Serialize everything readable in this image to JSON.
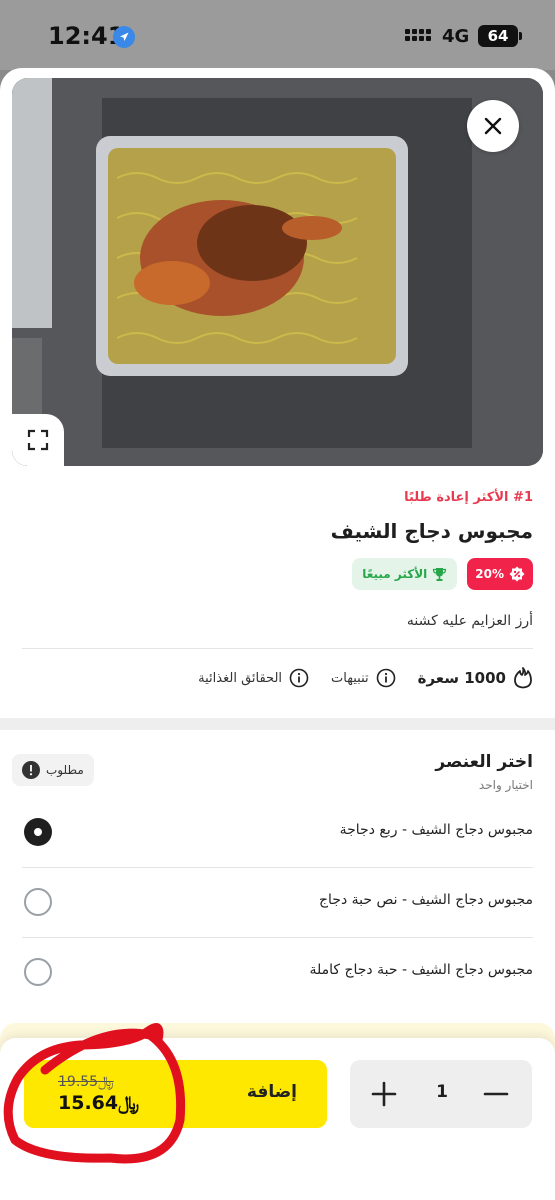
{
  "status_bar": {
    "time": "12:41",
    "network": "4G",
    "battery": "64"
  },
  "product": {
    "reorder_tag": "#1 الأكثر إعادة طلبًا",
    "name": "مجبوس دجاج الشيف",
    "discount_badge": "20%",
    "best_seller_badge": "الأكثر مبيعًا",
    "description": "أرز العزايم عليه كشنه",
    "calories": "1000 سعرة",
    "alerts_label": "تنبيهات",
    "nutrition_label": "الحقائق الغذائية"
  },
  "options": {
    "title": "اختر العنصر",
    "subtitle": "اختيار واحد",
    "required_label": "مطلوب",
    "items": [
      {
        "label": "مجبوس دجاج الشيف - ربع دجاجة",
        "selected": true
      },
      {
        "label": "مجبوس دجاج الشيف - نص حبة دجاج",
        "selected": false
      },
      {
        "label": "مجبوس دجاج الشيف - حبة دجاج كاملة",
        "selected": false
      }
    ]
  },
  "cart": {
    "add_label": "إضافة",
    "old_price": "19.55",
    "new_price": "15.64",
    "quantity": "1"
  },
  "colors": {
    "accent_yellow": "#ffe800",
    "discount_red": "#f2234a",
    "best_seller_green": "#27a64a",
    "annotation_red": "#e0101f"
  },
  "icons": [
    "location-arrow-icon",
    "close-icon",
    "expand-icon",
    "discount-icon",
    "trophy-icon",
    "flame-icon",
    "info-icon",
    "alert-icon",
    "plus-icon",
    "minus-icon",
    "riyal-icon"
  ]
}
